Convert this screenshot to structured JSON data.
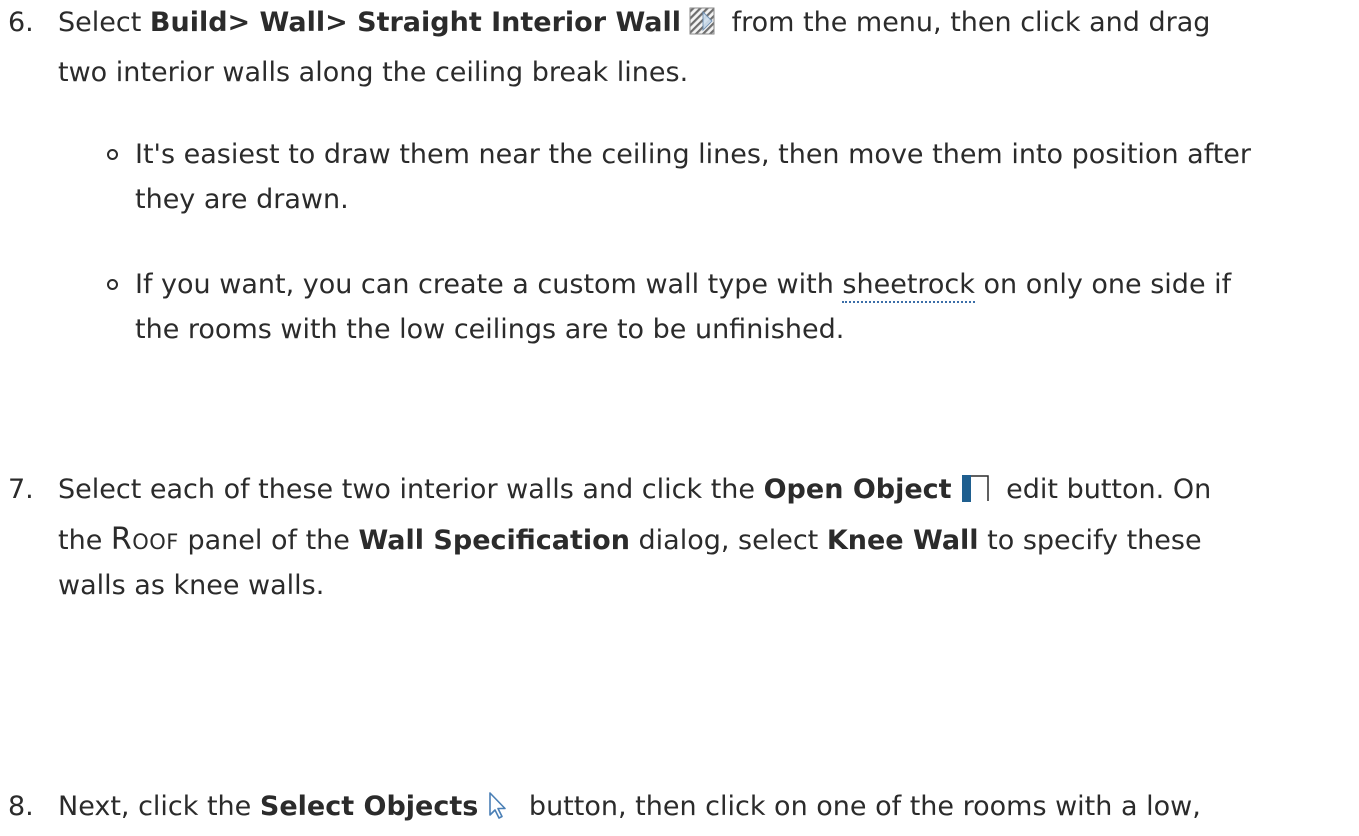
{
  "step6": {
    "number": "6.",
    "t1": "Select ",
    "b1": "Build> Wall> Straight Interior Wall",
    "t2": " from the menu, then click and drag",
    "line2": "two interior walls along the ceiling break lines.",
    "icon": "straight-interior-wall-icon"
  },
  "bullet1": {
    "line1": "It's easiest to draw them near the ceiling lines, then move them into position after",
    "line2": "they are drawn."
  },
  "bullet2": {
    "t1": "If you want, you can create a custom wall type with ",
    "link": "sheetrock",
    "t2": " on only one side if",
    "line2": "the rooms with the low ceilings are to be unfinished."
  },
  "step7": {
    "number": "7.",
    "t1": "Select each of these two interior walls and click the ",
    "b1": "Open Object",
    "t2": " edit button. On",
    "l2a": "the ",
    "roof": "Roof",
    "l2b": " panel of the ",
    "b2": "Wall Specification",
    "l2c": " dialog, select ",
    "b3": "Knee Wall",
    "l2d": " to specify these",
    "line3": "walls as knee walls.",
    "icon": "open-object-icon"
  },
  "step8": {
    "number": "8.",
    "t1": "Next, click the ",
    "b1": "Select Objects",
    "t2": " button, then click on one of the rooms with a low,",
    "icon": "select-objects-arrow-icon"
  },
  "colors": {
    "text": "#2b2b2b",
    "link_underline": "#3b6ea8",
    "open_object_blue": "#1f5f8f"
  }
}
